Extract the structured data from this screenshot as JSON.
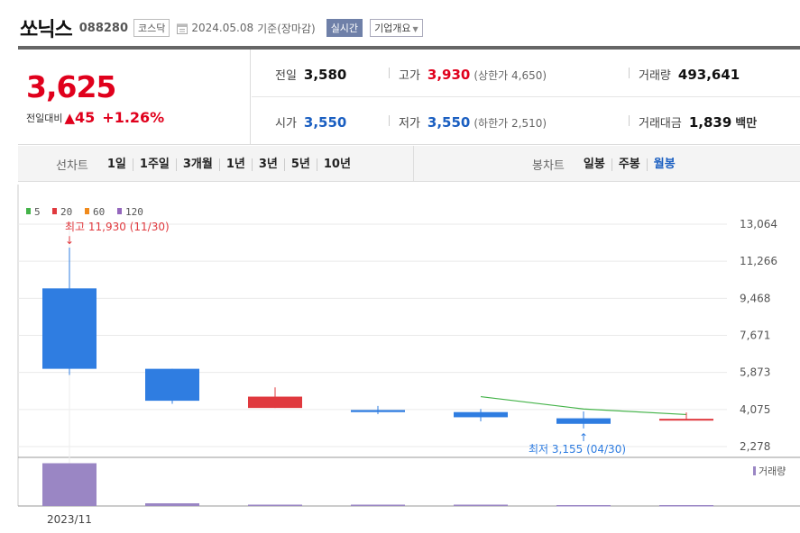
{
  "header": {
    "stock_name": "쏘닉스",
    "stock_code": "088280",
    "market": "코스닥",
    "date": "2024.05.08",
    "basis": "기준(장마감)",
    "realtime_label": "실시간",
    "company_info_label": "기업개요"
  },
  "quote": {
    "price": "3,625",
    "change_label": "전일대비",
    "change_arrow": "▲",
    "change_value": "45",
    "change_rate": "+1.26%",
    "prev_close_label": "전일",
    "prev_close": "3,580",
    "high_label": "고가",
    "high": "3,930",
    "upper_limit": "(상한가 4,650)",
    "volume_label": "거래량",
    "volume": "493,641",
    "open_label": "시가",
    "open": "3,550",
    "low_label": "저가",
    "low": "3,550",
    "lower_limit": "(하한가 2,510)",
    "amount_label": "거래대금",
    "amount": "1,839",
    "amount_unit": "백만"
  },
  "tabs": {
    "line_label": "선차트",
    "line_items": [
      "1일",
      "1주일",
      "3개월",
      "1년",
      "3년",
      "5년",
      "10년"
    ],
    "candle_label": "봉차트",
    "candle_items": [
      "일봉",
      "주봉",
      "월봉"
    ],
    "active_candle": "월봉"
  },
  "chart_data": {
    "type": "candlestick",
    "legend": [
      {
        "name": "5",
        "color": "#44b349"
      },
      {
        "name": "20",
        "color": "#e0393e"
      },
      {
        "name": "60",
        "color": "#f08a1c"
      },
      {
        "name": "120",
        "color": "#9467bd"
      }
    ],
    "y_ticks": [
      13064,
      11266,
      9468,
      7671,
      5873,
      4075,
      2278
    ],
    "y_tick_labels": [
      "13,064",
      "11,266",
      "9,468",
      "7,671",
      "5,873",
      "4,075",
      "2,278"
    ],
    "ylim": [
      2278,
      13064
    ],
    "x_tick_labels": [
      "2023/11"
    ],
    "candles": [
      {
        "open": 9950,
        "close": 6050,
        "high": 11930,
        "low": 5750
      },
      {
        "open": 6050,
        "close": 4500,
        "high": 6050,
        "low": 4350
      },
      {
        "open": 4150,
        "close": 4700,
        "high": 5150,
        "low": 4150
      },
      {
        "open": 4050,
        "close": 3950,
        "high": 4250,
        "low": 3850
      },
      {
        "open": 3950,
        "close": 3700,
        "high": 4100,
        "low": 3500
      },
      {
        "open": 3650,
        "close": 3380,
        "high": 3980,
        "low": 3155
      },
      {
        "open": 3550,
        "close": 3625,
        "high": 3930,
        "low": 3550
      }
    ],
    "ma5": [
      null,
      null,
      null,
      null,
      4700,
      4100,
      3830
    ],
    "colors": {
      "up": "#e0393e",
      "down": "#2f7de1"
    },
    "high_annotation": "최고 11,930 (11/30)",
    "low_annotation": "최저 3,155 (04/30)",
    "volume_label": "거래량",
    "volume": [
      0.95,
      0.06,
      0.03,
      0.03,
      0.03,
      0.02,
      0.02
    ],
    "volume_color": "#9a86c4"
  }
}
